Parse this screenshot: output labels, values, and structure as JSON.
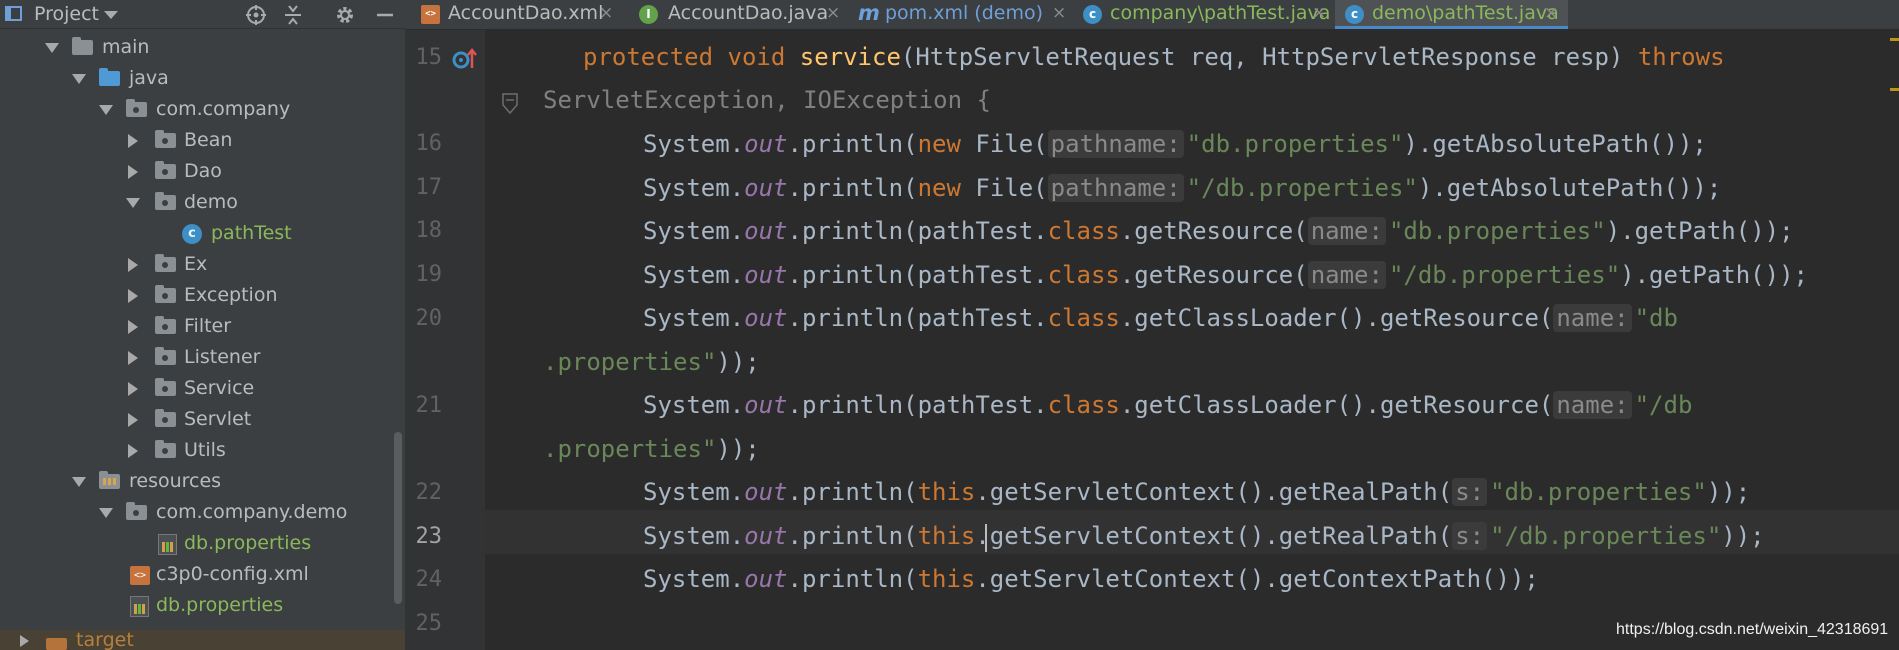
{
  "project_panel": {
    "title": "Project",
    "tools": [
      "target-icon",
      "collapse-icon",
      "gear-icon",
      "minimize-icon"
    ],
    "tree": [
      {
        "label": "main",
        "icon": "folder-icon"
      },
      {
        "label": "java",
        "icon": "source-folder-icon"
      },
      {
        "label": "com.company",
        "icon": "package-icon"
      },
      {
        "label": "Bean",
        "icon": "package-icon"
      },
      {
        "label": "Dao",
        "icon": "package-icon"
      },
      {
        "label": "demo",
        "icon": "package-icon"
      },
      {
        "label": "pathTest",
        "icon": "class-icon"
      },
      {
        "label": "Ex",
        "icon": "package-icon"
      },
      {
        "label": "Exception",
        "icon": "package-icon"
      },
      {
        "label": "Filter",
        "icon": "package-icon"
      },
      {
        "label": "Listener",
        "icon": "package-icon"
      },
      {
        "label": "Service",
        "icon": "package-icon"
      },
      {
        "label": "Servlet",
        "icon": "package-icon"
      },
      {
        "label": "Utils",
        "icon": "package-icon"
      },
      {
        "label": "resources",
        "icon": "resources-folder-icon"
      },
      {
        "label": "com.company.demo",
        "icon": "package-icon"
      },
      {
        "label": "db.properties",
        "icon": "properties-file-icon"
      },
      {
        "label": "c3p0-config.xml",
        "icon": "xml-file-icon"
      },
      {
        "label": "db.properties",
        "icon": "properties-file-icon"
      },
      {
        "label": "target",
        "icon": "folder-icon"
      }
    ]
  },
  "tabs": [
    {
      "label": "AccountDao.xml",
      "icon": "xml-file-icon",
      "close": "×"
    },
    {
      "label": "AccountDao.java",
      "icon": "interface-icon",
      "close": "×"
    },
    {
      "label": "pom.xml (demo)",
      "icon": "maven-icon",
      "close": "×"
    },
    {
      "label": "company\\pathTest.java",
      "icon": "class-icon",
      "close": "×"
    },
    {
      "label": "demo\\pathTest.java",
      "icon": "class-icon",
      "close": "×"
    }
  ],
  "editor": {
    "line_numbers": [
      "15",
      "16",
      "17",
      "18",
      "19",
      "20",
      "21",
      "22",
      "23",
      "24",
      "25"
    ],
    "current_line": "23",
    "strings": {
      "protected": "protected",
      "void": "void",
      "service": "service",
      "sig1": "(HttpServletRequest req, HttpServletResponse resp) ",
      "throws": "throws",
      "sig2": "ServletException, IOException {",
      "system": "System.",
      "out": "out",
      "println": ".println(",
      "new": "new",
      "file": " File(",
      "pathname_hint": "pathname:",
      "name_hint": "name:",
      "s_hint": "s:",
      "str_db": "\"db.properties\"",
      "str_slash_db": "\"/db.properties\"",
      "get_abs": ").getAbsolutePath());",
      "pathtest": "pathTest.",
      "class": "class",
      "get_resource": ".getResource(",
      "get_path": ").getPath());",
      "get_classloader": ".getClassLoader().getResource(",
      "str_db_a": "\"db",
      "str_db_b": ".properties\"",
      "str_slash_db_a": "\"/db",
      "close2": "));",
      "this": "this",
      "get_real": ".getServletContext().getRealPath(",
      "get_ctx": ".getServletContext().getContextPath());",
      "semi": ";"
    }
  },
  "watermark": "https://blog.csdn.net/weixin_42318691",
  "colors": {
    "keyword": "#cc7832",
    "method_decl": "#ffc66d",
    "string": "#6a8759",
    "static_field": "#9876aa",
    "text": "#a9b7c6",
    "background": "#2b2b2b"
  }
}
